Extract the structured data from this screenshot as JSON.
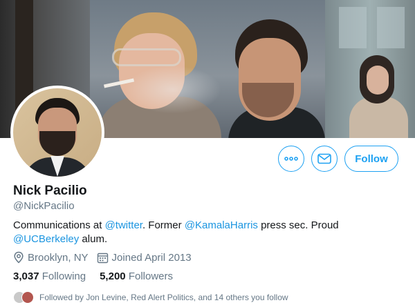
{
  "profile": {
    "name": "Nick Pacilio",
    "handle": "@NickPacilio",
    "bio": {
      "p1": "Communications at ",
      "l1": "@twitter",
      "p2": ". Former ",
      "l2": "@KamalaHarris",
      "p3": " press sec. Proud ",
      "l3": "@UCBerkeley",
      "p4": " alum."
    },
    "location": "Brooklyn, NY",
    "joined": "Joined April 2013",
    "following_count": "3,037",
    "following_label": "Following",
    "followers_count": "5,200",
    "followers_label": "Followers",
    "followed_by": "Followed by Jon Levine, Red Alert Politics, and 14 others you follow"
  },
  "actions": {
    "follow_label": "Follow"
  },
  "icons": {
    "more": "more-dots-icon",
    "mail": "envelope-icon",
    "location": "location-pin-icon",
    "calendar": "calendar-icon"
  },
  "colors": {
    "accent": "#1da1f2",
    "link": "#1b95e0",
    "secondary_text": "#657786",
    "primary_text": "#14171a"
  }
}
